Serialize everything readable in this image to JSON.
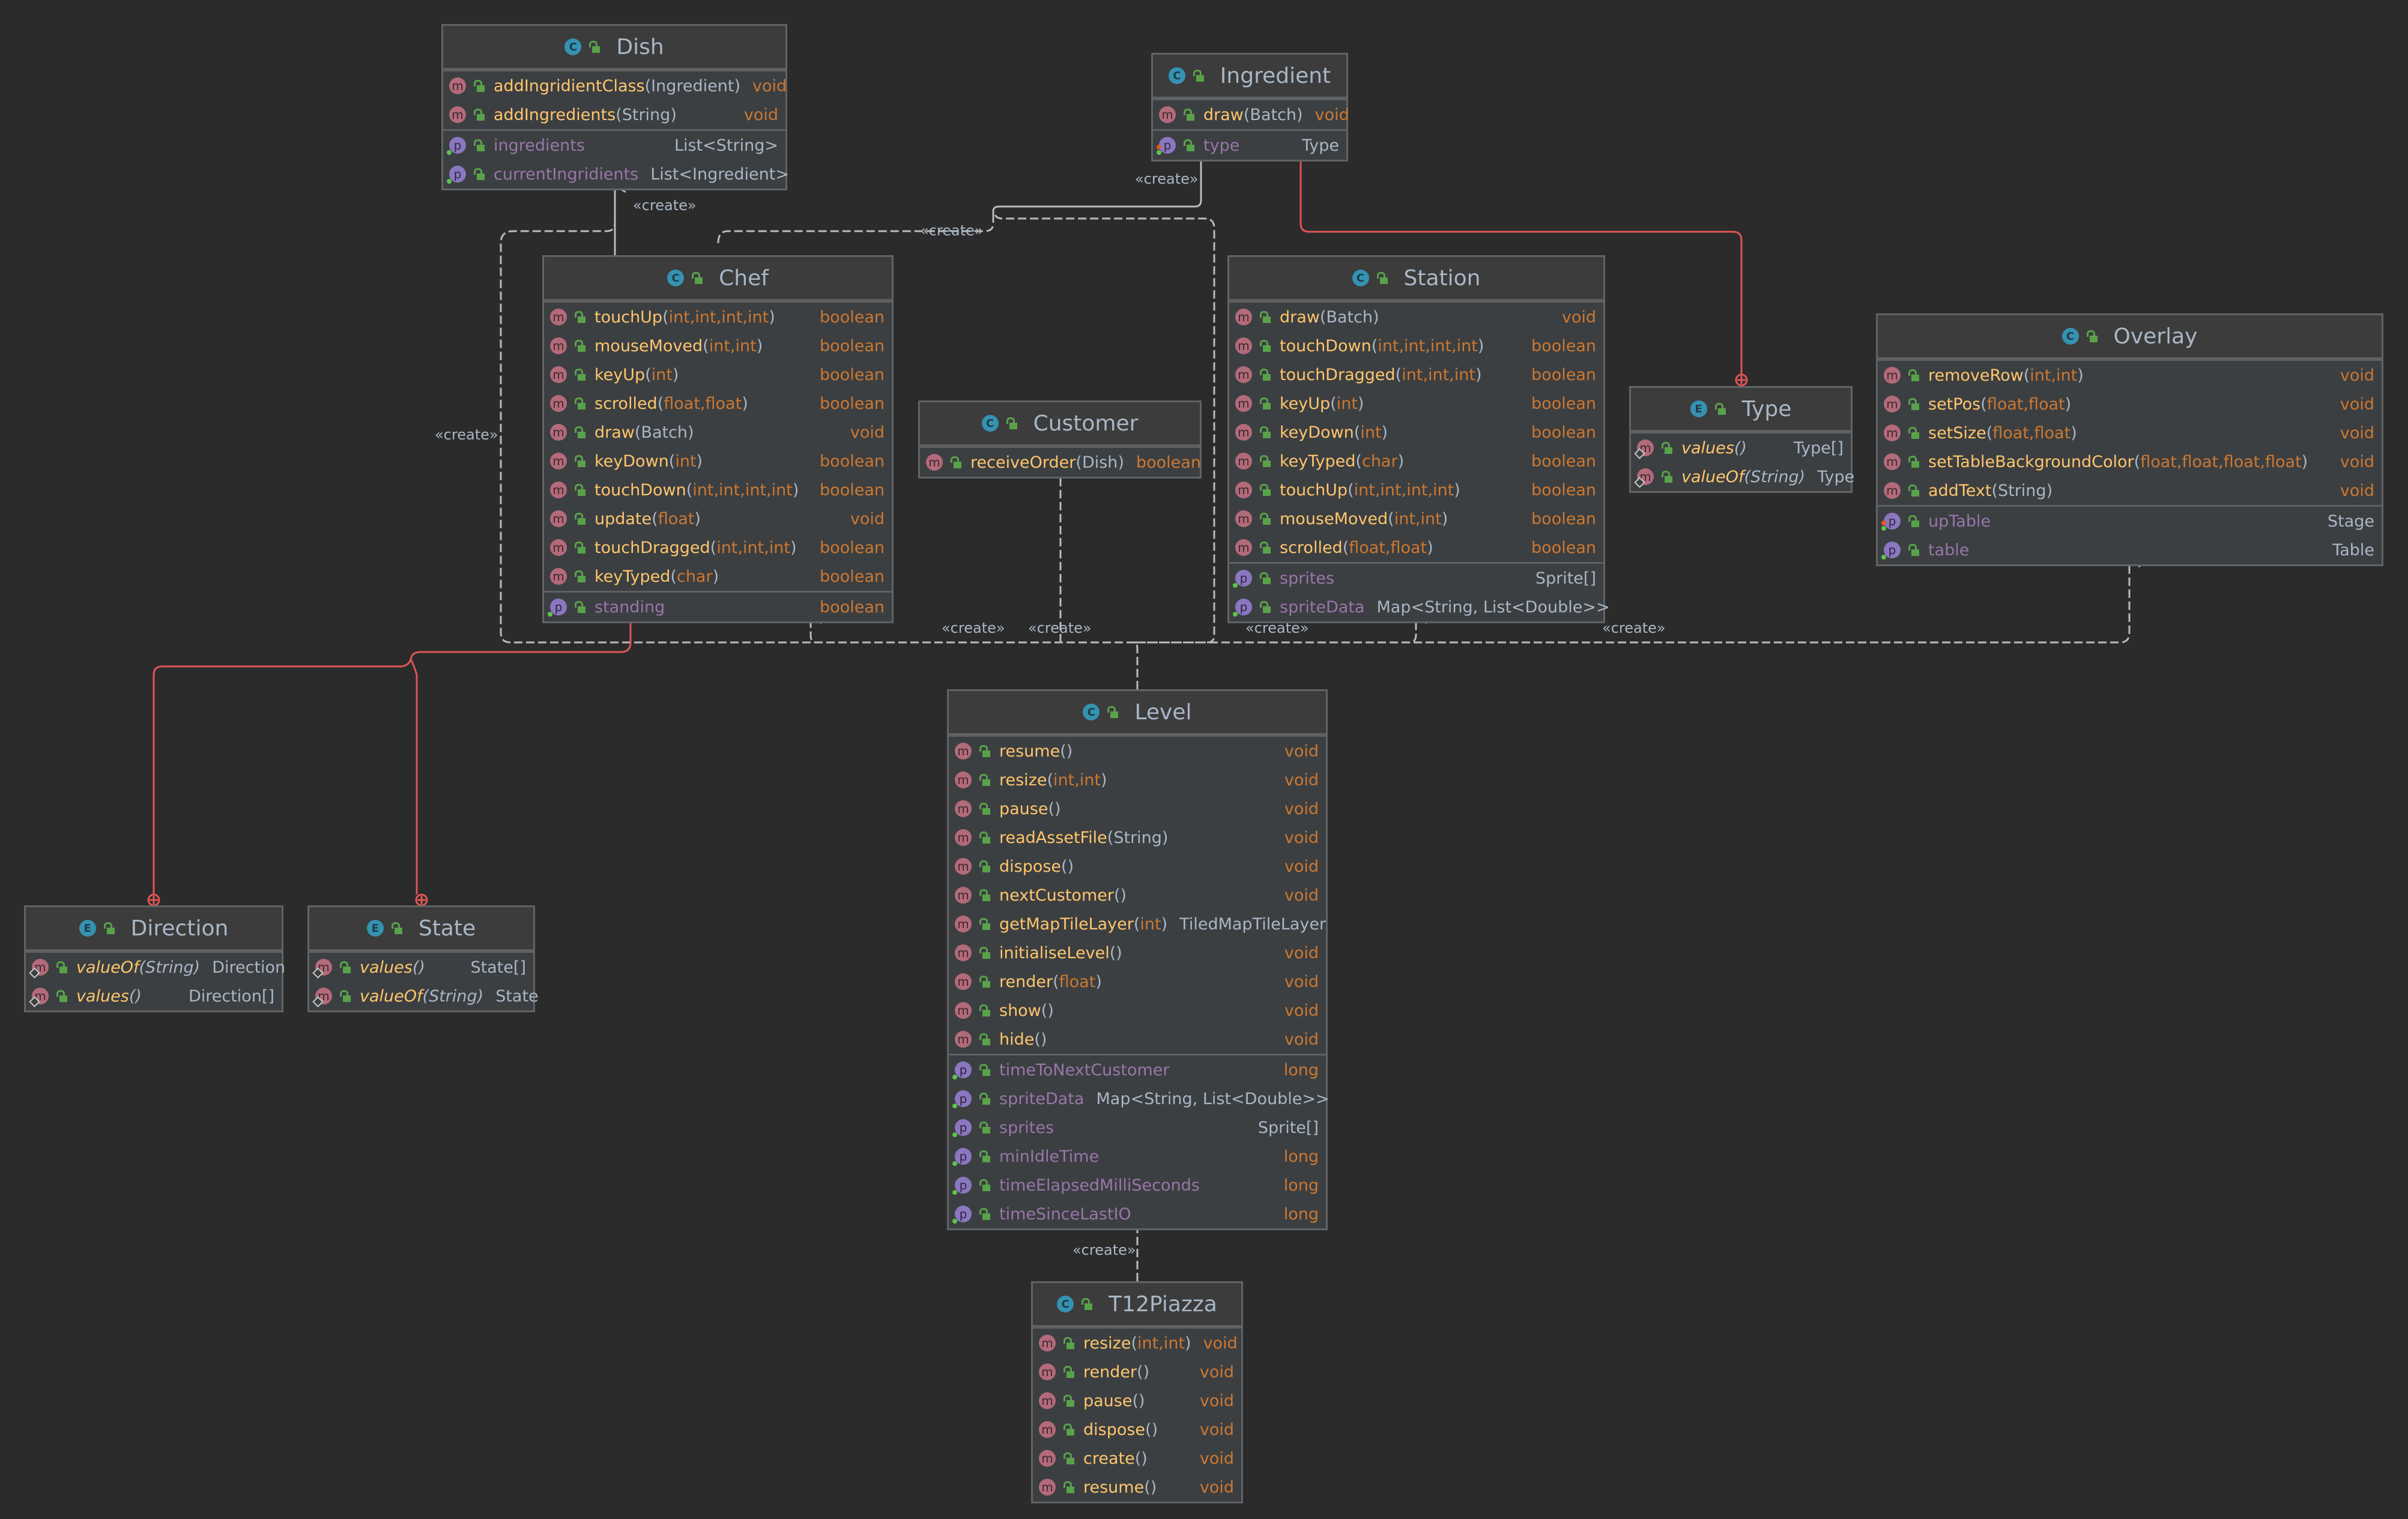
{
  "diagram": {
    "stereotype": "«create»",
    "colors": {
      "background": "#2b2b2b",
      "box_body": "#3c3f41",
      "box_header": "#3c3c3c",
      "method_name": "#ffc66d",
      "keyword_type": "#cc7832",
      "class_type": "#a9b7c6",
      "property_name": "#9876aa",
      "class_badge": "#3592b1",
      "method_badge": "#b36a7a",
      "property_badge": "#8a77c0",
      "visibility_lock": "#59a24a",
      "inner_class_edge": "#e05555",
      "dependency_edge": "#bbbbbb"
    },
    "classes": {
      "dish": {
        "kind": "C",
        "name": "Dish",
        "methods": [
          {
            "name": "addIngridientClass",
            "params": [
              {
                "t": "Ingredient",
                "k": false
              }
            ],
            "ret": "void",
            "retk": true
          },
          {
            "name": "addIngredients",
            "params": [
              {
                "t": "String",
                "k": false
              }
            ],
            "ret": "void",
            "retk": true
          }
        ],
        "props": [
          {
            "name": "ingredients",
            "type": "List<String>",
            "typek": false
          },
          {
            "name": "currentIngridients",
            "type": "List<Ingredient>",
            "typek": false
          }
        ]
      },
      "ingredient": {
        "kind": "C",
        "name": "Ingredient",
        "methods": [
          {
            "name": "draw",
            "params": [
              {
                "t": "Batch",
                "k": false
              }
            ],
            "ret": "void",
            "retk": true
          }
        ],
        "props": [
          {
            "name": "type",
            "type": "Type",
            "typek": false,
            "final": true
          }
        ]
      },
      "chef": {
        "kind": "C",
        "name": "Chef",
        "methods": [
          {
            "name": "touchUp",
            "params": [
              {
                "t": "int",
                "k": true
              },
              {
                "t": "int",
                "k": true
              },
              {
                "t": "int",
                "k": true
              },
              {
                "t": "int",
                "k": true
              }
            ],
            "ret": "boolean",
            "retk": true
          },
          {
            "name": "mouseMoved",
            "params": [
              {
                "t": "int",
                "k": true
              },
              {
                "t": "int",
                "k": true
              }
            ],
            "ret": "boolean",
            "retk": true
          },
          {
            "name": "keyUp",
            "params": [
              {
                "t": "int",
                "k": true
              }
            ],
            "ret": "boolean",
            "retk": true
          },
          {
            "name": "scrolled",
            "params": [
              {
                "t": "float",
                "k": true
              },
              {
                "t": "float",
                "k": true
              }
            ],
            "ret": "boolean",
            "retk": true
          },
          {
            "name": "draw",
            "params": [
              {
                "t": "Batch",
                "k": false
              }
            ],
            "ret": "void",
            "retk": true
          },
          {
            "name": "keyDown",
            "params": [
              {
                "t": "int",
                "k": true
              }
            ],
            "ret": "boolean",
            "retk": true
          },
          {
            "name": "touchDown",
            "params": [
              {
                "t": "int",
                "k": true
              },
              {
                "t": "int",
                "k": true
              },
              {
                "t": "int",
                "k": true
              },
              {
                "t": "int",
                "k": true
              }
            ],
            "ret": "boolean",
            "retk": true
          },
          {
            "name": "update",
            "params": [
              {
                "t": "float",
                "k": true
              }
            ],
            "ret": "void",
            "retk": true
          },
          {
            "name": "touchDragged",
            "params": [
              {
                "t": "int",
                "k": true
              },
              {
                "t": "int",
                "k": true
              },
              {
                "t": "int",
                "k": true
              }
            ],
            "ret": "boolean",
            "retk": true
          },
          {
            "name": "keyTyped",
            "params": [
              {
                "t": "char",
                "k": true
              }
            ],
            "ret": "boolean",
            "retk": true
          }
        ],
        "props": [
          {
            "name": "standing",
            "type": "boolean",
            "typek": true
          }
        ]
      },
      "customer": {
        "kind": "C",
        "name": "Customer",
        "methods": [
          {
            "name": "receiveOrder",
            "params": [
              {
                "t": "Dish",
                "k": false
              }
            ],
            "ret": "boolean",
            "retk": true
          }
        ],
        "props": []
      },
      "station": {
        "kind": "C",
        "name": "Station",
        "methods": [
          {
            "name": "draw",
            "params": [
              {
                "t": "Batch",
                "k": false
              }
            ],
            "ret": "void",
            "retk": true
          },
          {
            "name": "touchDown",
            "params": [
              {
                "t": "int",
                "k": true
              },
              {
                "t": "int",
                "k": true
              },
              {
                "t": "int",
                "k": true
              },
              {
                "t": "int",
                "k": true
              }
            ],
            "ret": "boolean",
            "retk": true
          },
          {
            "name": "touchDragged",
            "params": [
              {
                "t": "int",
                "k": true
              },
              {
                "t": "int",
                "k": true
              },
              {
                "t": "int",
                "k": true
              }
            ],
            "ret": "boolean",
            "retk": true
          },
          {
            "name": "keyUp",
            "params": [
              {
                "t": "int",
                "k": true
              }
            ],
            "ret": "boolean",
            "retk": true
          },
          {
            "name": "keyDown",
            "params": [
              {
                "t": "int",
                "k": true
              }
            ],
            "ret": "boolean",
            "retk": true
          },
          {
            "name": "keyTyped",
            "params": [
              {
                "t": "char",
                "k": true
              }
            ],
            "ret": "boolean",
            "retk": true
          },
          {
            "name": "touchUp",
            "params": [
              {
                "t": "int",
                "k": true
              },
              {
                "t": "int",
                "k": true
              },
              {
                "t": "int",
                "k": true
              },
              {
                "t": "int",
                "k": true
              }
            ],
            "ret": "boolean",
            "retk": true
          },
          {
            "name": "mouseMoved",
            "params": [
              {
                "t": "int",
                "k": true
              },
              {
                "t": "int",
                "k": true
              }
            ],
            "ret": "boolean",
            "retk": true
          },
          {
            "name": "scrolled",
            "params": [
              {
                "t": "float",
                "k": true
              },
              {
                "t": "float",
                "k": true
              }
            ],
            "ret": "boolean",
            "retk": true
          }
        ],
        "props": [
          {
            "name": "sprites",
            "type": "Sprite[]",
            "typek": false
          },
          {
            "name": "spriteData",
            "type": "Map<String, List<Double>>",
            "typek": false
          }
        ]
      },
      "type": {
        "kind": "E",
        "name": "Type",
        "methods": [
          {
            "name": "values",
            "params": [],
            "ret": "Type[]",
            "retk": false,
            "static": true
          },
          {
            "name": "valueOf",
            "params": [
              {
                "t": "String",
                "k": false
              }
            ],
            "ret": "Type",
            "retk": false,
            "static": true
          }
        ],
        "props": []
      },
      "overlay": {
        "kind": "C",
        "name": "Overlay",
        "methods": [
          {
            "name": "removeRow",
            "params": [
              {
                "t": "int",
                "k": true
              },
              {
                "t": "int",
                "k": true
              }
            ],
            "ret": "void",
            "retk": true
          },
          {
            "name": "setPos",
            "params": [
              {
                "t": "float",
                "k": true
              },
              {
                "t": "float",
                "k": true
              }
            ],
            "ret": "void",
            "retk": true
          },
          {
            "name": "setSize",
            "params": [
              {
                "t": "float",
                "k": true
              },
              {
                "t": "float",
                "k": true
              }
            ],
            "ret": "void",
            "retk": true
          },
          {
            "name": "setTableBackgroundColor",
            "params": [
              {
                "t": "float",
                "k": true
              },
              {
                "t": "float",
                "k": true
              },
              {
                "t": "float",
                "k": true
              },
              {
                "t": "float",
                "k": true
              }
            ],
            "ret": "void",
            "retk": true
          },
          {
            "name": "addText",
            "params": [
              {
                "t": "String",
                "k": false
              }
            ],
            "ret": "void",
            "retk": true
          }
        ],
        "props": [
          {
            "name": "upTable",
            "type": "Stage",
            "typek": false,
            "final": true
          },
          {
            "name": "table",
            "type": "Table",
            "typek": false
          }
        ]
      },
      "level": {
        "kind": "C",
        "name": "Level",
        "methods": [
          {
            "name": "resume",
            "params": [],
            "ret": "void",
            "retk": true
          },
          {
            "name": "resize",
            "params": [
              {
                "t": "int",
                "k": true
              },
              {
                "t": "int",
                "k": true
              }
            ],
            "ret": "void",
            "retk": true
          },
          {
            "name": "pause",
            "params": [],
            "ret": "void",
            "retk": true
          },
          {
            "name": "readAssetFile",
            "params": [
              {
                "t": "String",
                "k": false
              }
            ],
            "ret": "void",
            "retk": true
          },
          {
            "name": "dispose",
            "params": [],
            "ret": "void",
            "retk": true
          },
          {
            "name": "nextCustomer",
            "params": [],
            "ret": "void",
            "retk": true
          },
          {
            "name": "getMapTileLayer",
            "params": [
              {
                "t": "int",
                "k": true
              }
            ],
            "ret": "TiledMapTileLayer",
            "retk": false
          },
          {
            "name": "initialiseLevel",
            "params": [],
            "ret": "void",
            "retk": true
          },
          {
            "name": "render",
            "params": [
              {
                "t": "float",
                "k": true
              }
            ],
            "ret": "void",
            "retk": true
          },
          {
            "name": "show",
            "params": [],
            "ret": "void",
            "retk": true
          },
          {
            "name": "hide",
            "params": [],
            "ret": "void",
            "retk": true
          }
        ],
        "props": [
          {
            "name": "timeToNextCustomer",
            "type": "long",
            "typek": true
          },
          {
            "name": "spriteData",
            "type": "Map<String, List<Double>>",
            "typek": false
          },
          {
            "name": "sprites",
            "type": "Sprite[]",
            "typek": false
          },
          {
            "name": "minIdleTime",
            "type": "long",
            "typek": true
          },
          {
            "name": "timeElapsedMilliSeconds",
            "type": "long",
            "typek": true
          },
          {
            "name": "timeSinceLastIO",
            "type": "long",
            "typek": true
          }
        ]
      },
      "t12piazza": {
        "kind": "C",
        "name": "T12Piazza",
        "methods": [
          {
            "name": "resize",
            "params": [
              {
                "t": "int",
                "k": true
              },
              {
                "t": "int",
                "k": true
              }
            ],
            "ret": "void",
            "retk": true
          },
          {
            "name": "render",
            "params": [],
            "ret": "void",
            "retk": true
          },
          {
            "name": "pause",
            "params": [],
            "ret": "void",
            "retk": true
          },
          {
            "name": "dispose",
            "params": [],
            "ret": "void",
            "retk": true
          },
          {
            "name": "create",
            "params": [],
            "ret": "void",
            "retk": true
          },
          {
            "name": "resume",
            "params": [],
            "ret": "void",
            "retk": true
          }
        ],
        "props": []
      },
      "direction": {
        "kind": "E",
        "name": "Direction",
        "methods": [
          {
            "name": "valueOf",
            "params": [
              {
                "t": "String",
                "k": false
              }
            ],
            "ret": "Direction",
            "retk": false,
            "static": true
          },
          {
            "name": "values",
            "params": [],
            "ret": "Direction[]",
            "retk": false,
            "static": true
          }
        ],
        "props": []
      },
      "state": {
        "kind": "E",
        "name": "State",
        "methods": [
          {
            "name": "values",
            "params": [],
            "ret": "State[]",
            "retk": false,
            "static": true
          },
          {
            "name": "valueOf",
            "params": [
              {
                "t": "String",
                "k": false
              }
            ],
            "ret": "State",
            "retk": false,
            "static": true
          }
        ],
        "props": []
      }
    },
    "relations": [
      {
        "from": "Chef",
        "to": "Dish",
        "type": "create"
      },
      {
        "from": "Chef",
        "to": "Ingredient",
        "type": "create"
      },
      {
        "from": "Level",
        "to": "Chef",
        "type": "create"
      },
      {
        "from": "Level",
        "to": "Customer",
        "type": "create"
      },
      {
        "from": "Level",
        "to": "Station",
        "type": "create"
      },
      {
        "from": "Level",
        "to": "Overlay",
        "type": "create"
      },
      {
        "from": "Level",
        "to": "Dish",
        "type": "create"
      },
      {
        "from": "Level",
        "to": "Ingredient",
        "type": "create"
      },
      {
        "from": "T12Piazza",
        "to": "Level",
        "type": "create"
      },
      {
        "from": "Ingredient",
        "to": "Type",
        "type": "inner"
      },
      {
        "from": "Chef",
        "to": "Direction",
        "type": "inner"
      },
      {
        "from": "Chef",
        "to": "State",
        "type": "inner"
      }
    ]
  }
}
